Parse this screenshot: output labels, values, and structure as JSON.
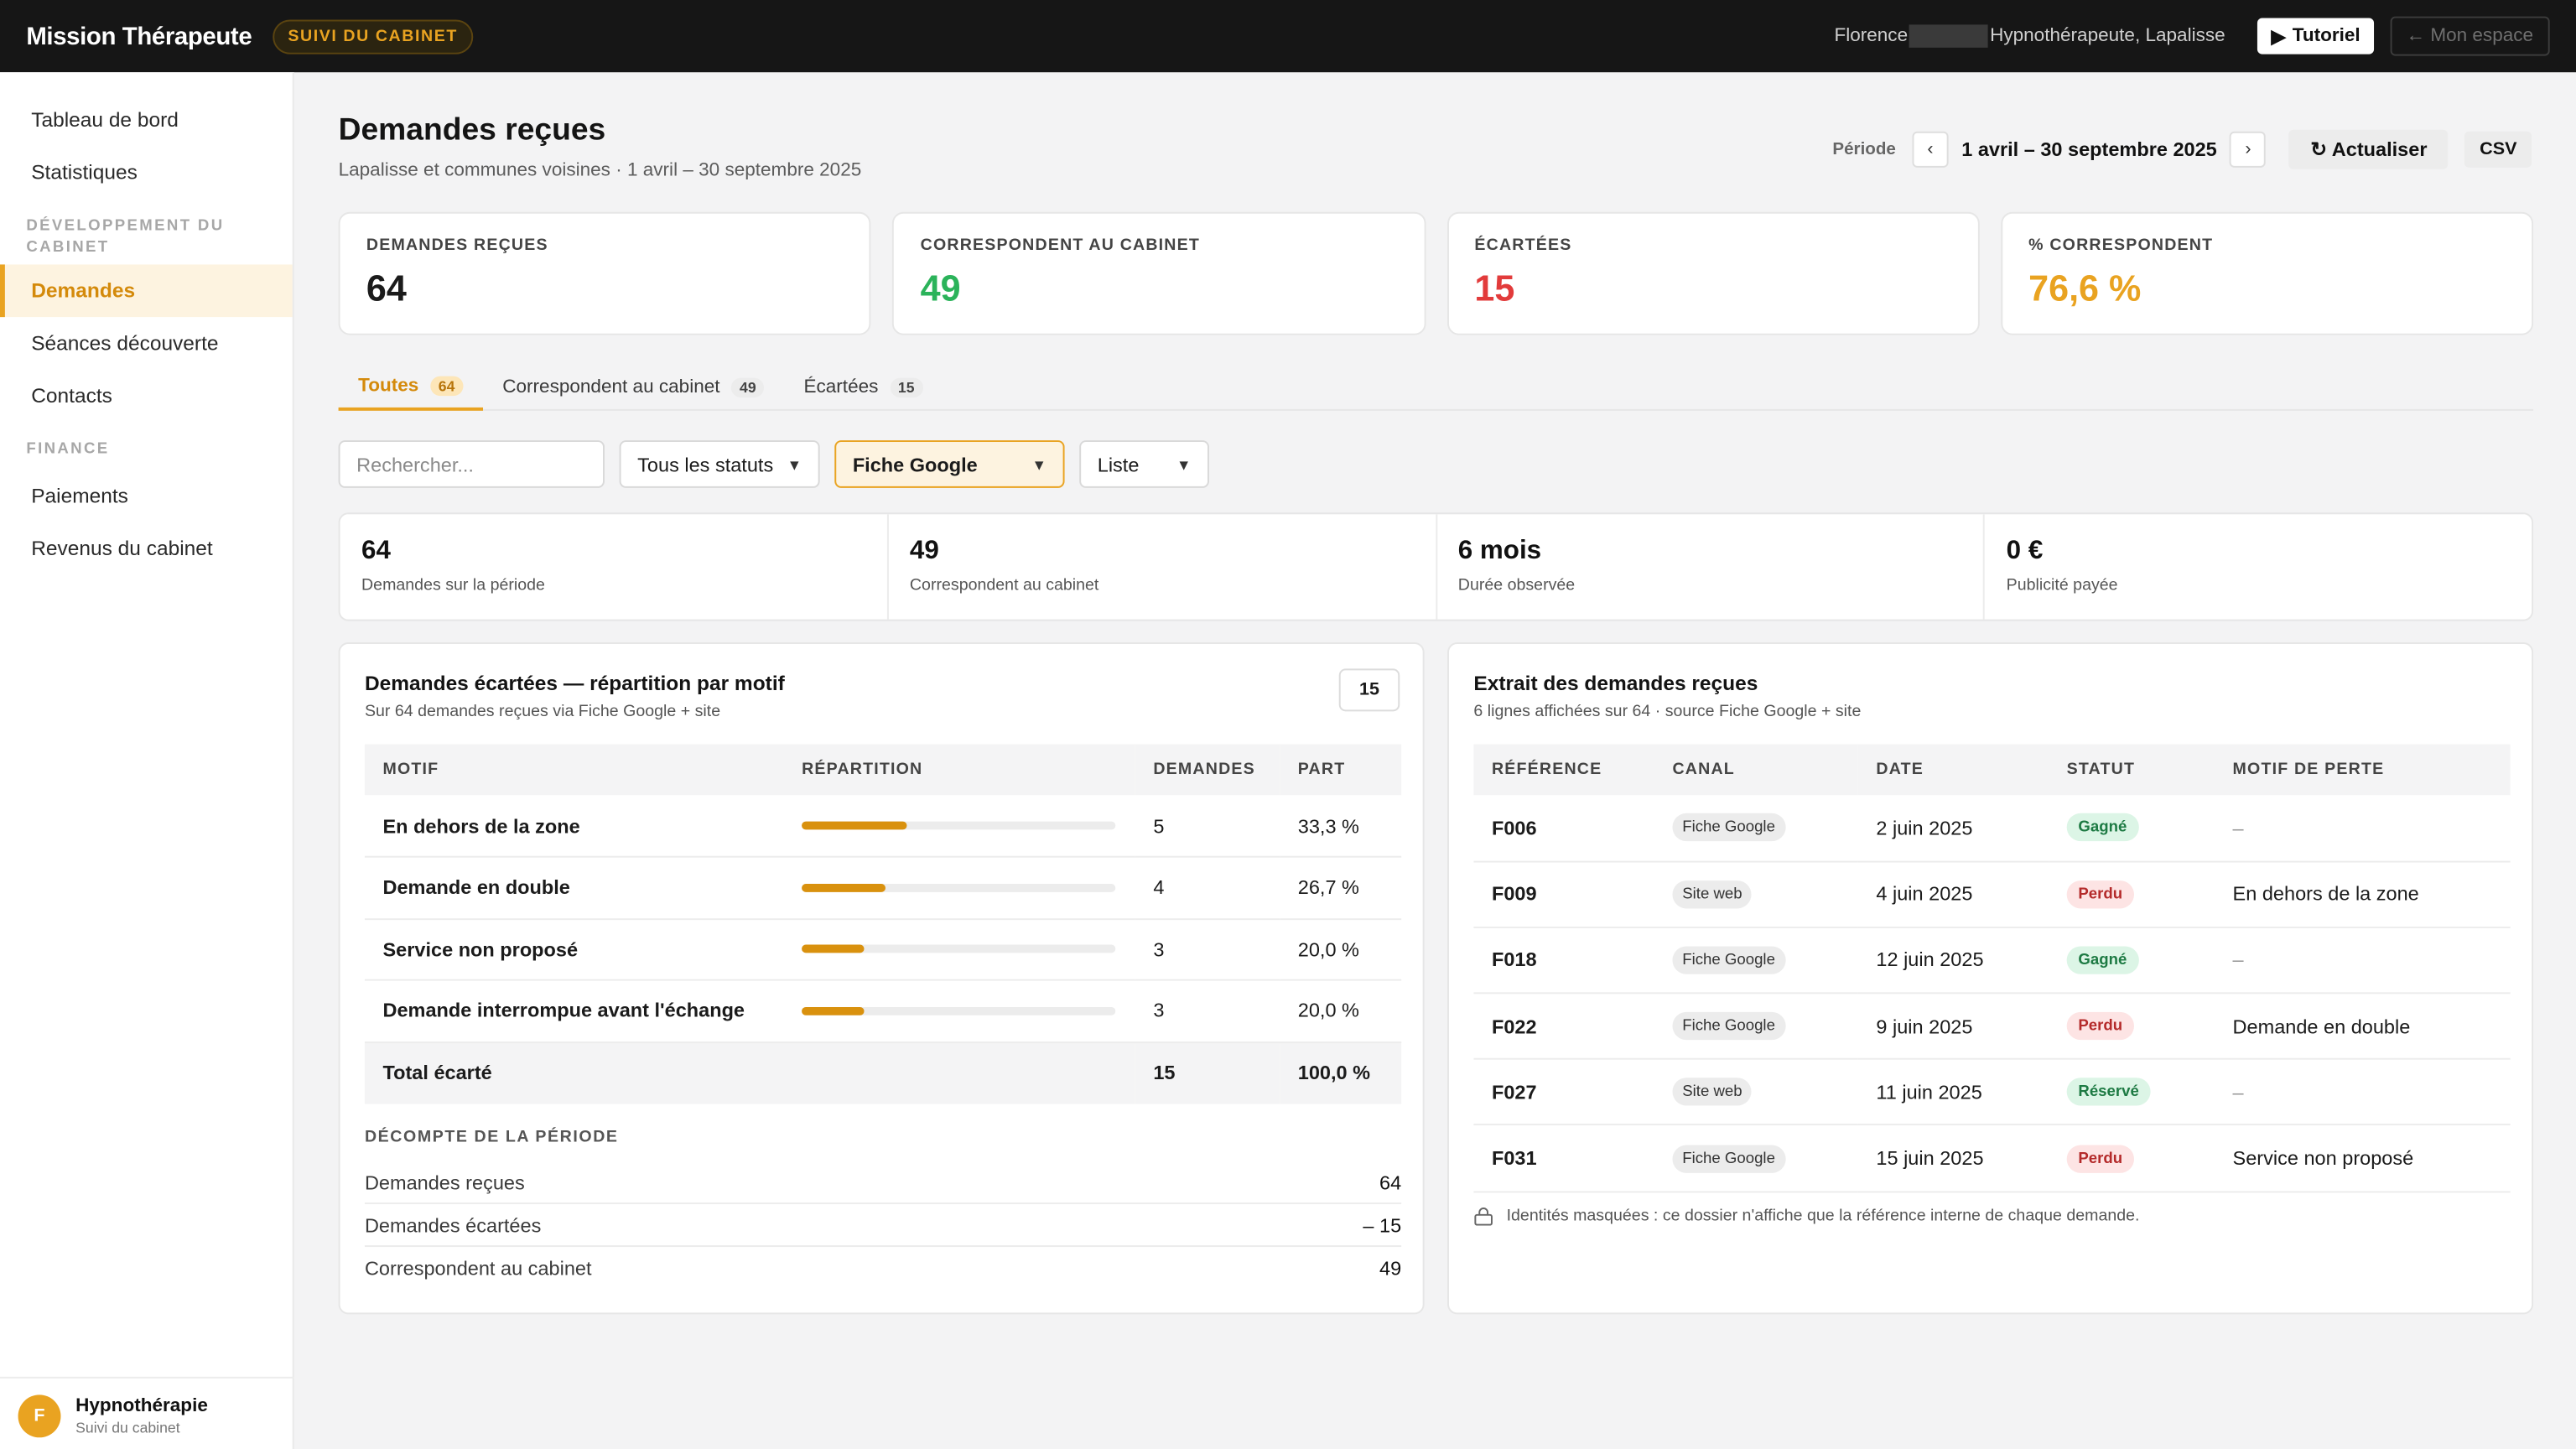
{
  "topbar": {
    "brand": "Mission Thérapeute",
    "badge": "SUIVI DU CABINET",
    "user_first": "Florence",
    "user_rest": "Hypnothérapeute, Lapalisse",
    "tutorial_label": "Tutoriel",
    "space_label": "← Mon espace"
  },
  "sidebar": {
    "items_top": [
      {
        "label": "Tableau de bord"
      },
      {
        "label": "Statistiques"
      }
    ],
    "section_dev": "DÉVELOPPEMENT DU CABINET",
    "items_dev": [
      {
        "label": "Demandes",
        "active": true
      },
      {
        "label": "Séances découverte"
      },
      {
        "label": "Contacts"
      }
    ],
    "section_finance": "FINANCE",
    "items_finance": [
      {
        "label": "Paiements"
      },
      {
        "label": "Revenus du cabinet"
      }
    ],
    "footer": {
      "avatar": "F",
      "name": "Hypnothérapie",
      "sub": "Suivi du cabinet"
    }
  },
  "header": {
    "title": "Demandes reçues",
    "subtitle": "Lapalisse et communes voisines · 1 avril – 30 septembre 2025",
    "period_label": "Période",
    "period_value": "1 avril – 30 septembre 2025",
    "refresh_label": "↻ Actualiser",
    "csv_label": "CSV"
  },
  "kpis": [
    {
      "label": "DEMANDES REÇUES",
      "value": "64",
      "color": "#1b1b1b"
    },
    {
      "label": "CORRESPONDENT AU CABINET",
      "value": "49",
      "color": "#2bb35a"
    },
    {
      "label": "ÉCARTÉES",
      "value": "15",
      "color": "#e23b3b"
    },
    {
      "label": "% CORRESPONDENT",
      "value": "76,6 %",
      "color": "#e9a321"
    }
  ],
  "tabs": [
    {
      "label": "Toutes",
      "count": "64",
      "active": true
    },
    {
      "label": "Correspondent au cabinet",
      "count": "49"
    },
    {
      "label": "Écartées",
      "count": "15"
    }
  ],
  "filters": {
    "search_placeholder": "Rechercher...",
    "status_select": "Tous les statuts",
    "source_select": "Fiche Google",
    "view_select": "Liste"
  },
  "stats": [
    {
      "value": "64",
      "label": "Demandes sur la période"
    },
    {
      "value": "49",
      "label": "Correspondent au cabinet"
    },
    {
      "value": "6 mois",
      "label": "Durée observée"
    },
    {
      "value": "0 €",
      "label": "Publicité payée"
    }
  ],
  "left_panel": {
    "title": "Demandes écartées — répartition par motif",
    "subtitle": "Sur 64 demandes reçues via Fiche Google + site",
    "count": "15",
    "columns": [
      "MOTIF",
      "RÉPARTITION",
      "DEMANDES",
      "PART"
    ],
    "rows": [
      {
        "motif": "En dehors de la zone",
        "share": 0.333,
        "demandes": "5",
        "part": "33,3 %"
      },
      {
        "motif": "Demande en double",
        "share": 0.267,
        "demandes": "4",
        "part": "26,7 %"
      },
      {
        "motif": "Service non proposé",
        "share": 0.2,
        "demandes": "3",
        "part": "20,0 %"
      },
      {
        "motif": "Demande interrompue avant l'échange",
        "share": 0.2,
        "demandes": "3",
        "part": "20,0 %"
      }
    ],
    "total": {
      "label": "Total écarté",
      "demandes": "15",
      "part": "100,0 %"
    },
    "decompte_title": "DÉCOMPTE DE LA PÉRIODE",
    "decompte": [
      {
        "label": "Demandes reçues",
        "value": "64"
      },
      {
        "label": "Demandes écartées",
        "value": "– 15"
      },
      {
        "label": "Correspondent au cabinet",
        "value": "49"
      }
    ]
  },
  "right_panel": {
    "title": "Extrait des demandes reçues",
    "subtitle": "6 lignes affichées sur 64 · source Fiche Google + site",
    "columns": [
      "RÉFÉRENCE",
      "CANAL",
      "DATE",
      "STATUT",
      "MOTIF DE PERTE"
    ],
    "rows": [
      {
        "ref": "F006",
        "canal": "Fiche Google",
        "date": "2 juin 2025",
        "statut": "Gagné",
        "kind": "gagne",
        "motif": "–"
      },
      {
        "ref": "F009",
        "canal": "Site web",
        "date": "4 juin 2025",
        "statut": "Perdu",
        "kind": "perdu",
        "motif": "En dehors de la zone"
      },
      {
        "ref": "F018",
        "canal": "Fiche Google",
        "date": "12 juin 2025",
        "statut": "Gagné",
        "kind": "gagne",
        "motif": "–"
      },
      {
        "ref": "F022",
        "canal": "Fiche Google",
        "date": "9 juin 2025",
        "statut": "Perdu",
        "kind": "perdu",
        "motif": "Demande en double"
      },
      {
        "ref": "F027",
        "canal": "Site web",
        "date": "11 juin 2025",
        "statut": "Réservé",
        "kind": "reserve",
        "motif": "–"
      },
      {
        "ref": "F031",
        "canal": "Fiche Google",
        "date": "15 juin 2025",
        "statut": "Perdu",
        "kind": "perdu",
        "motif": "Service non proposé"
      }
    ],
    "note": "Identités masquées : ce dossier n'affiche que la référence interne de chaque demande."
  }
}
